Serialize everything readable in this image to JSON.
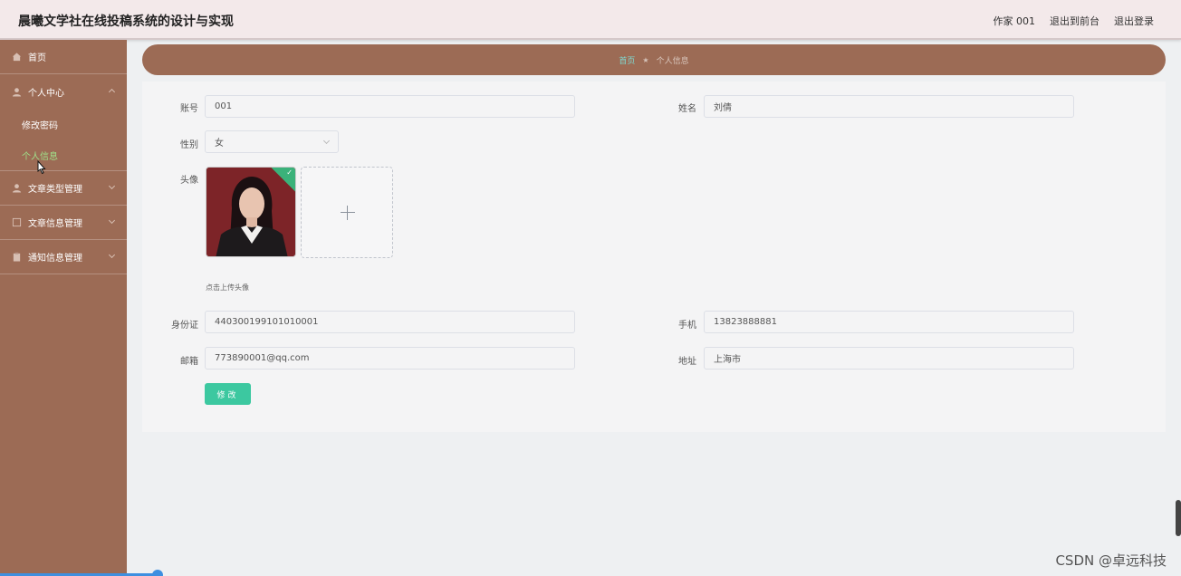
{
  "header": {
    "title": "晨曦文学社在线投稿系统的设计与实现",
    "user": "作家 001",
    "back_front": "退出到前台",
    "logout": "退出登录"
  },
  "sidebar": {
    "home": "首页",
    "personal_center": "个人中心",
    "change_password": "修改密码",
    "personal_info": "个人信息",
    "article_type": "文章类型管理",
    "article_info": "文章信息管理",
    "notice_info": "通知信息管理"
  },
  "breadcrumb": {
    "home": "首页",
    "separator": "★",
    "current": "个人信息"
  },
  "form": {
    "account_label": "账号",
    "account_value": "001",
    "name_label": "姓名",
    "name_value": "刘倩",
    "gender_label": "性别",
    "gender_value": "女",
    "avatar_label": "头像",
    "upload_hint": "点击上传头像",
    "id_label": "身份证",
    "id_value": "440300199101010001",
    "phone_label": "手机",
    "phone_value": "13823888881",
    "email_label": "邮箱",
    "email_value": "773890001@qq.com",
    "address_label": "地址",
    "address_value": "上海市",
    "submit_label": "修改"
  },
  "watermark": "CSDN @卓远科技",
  "colors": {
    "sidebar": "#9c6b55",
    "header": "#f3e9ea",
    "accent": "#3cc8a0",
    "active_menu": "#9fe08a"
  }
}
